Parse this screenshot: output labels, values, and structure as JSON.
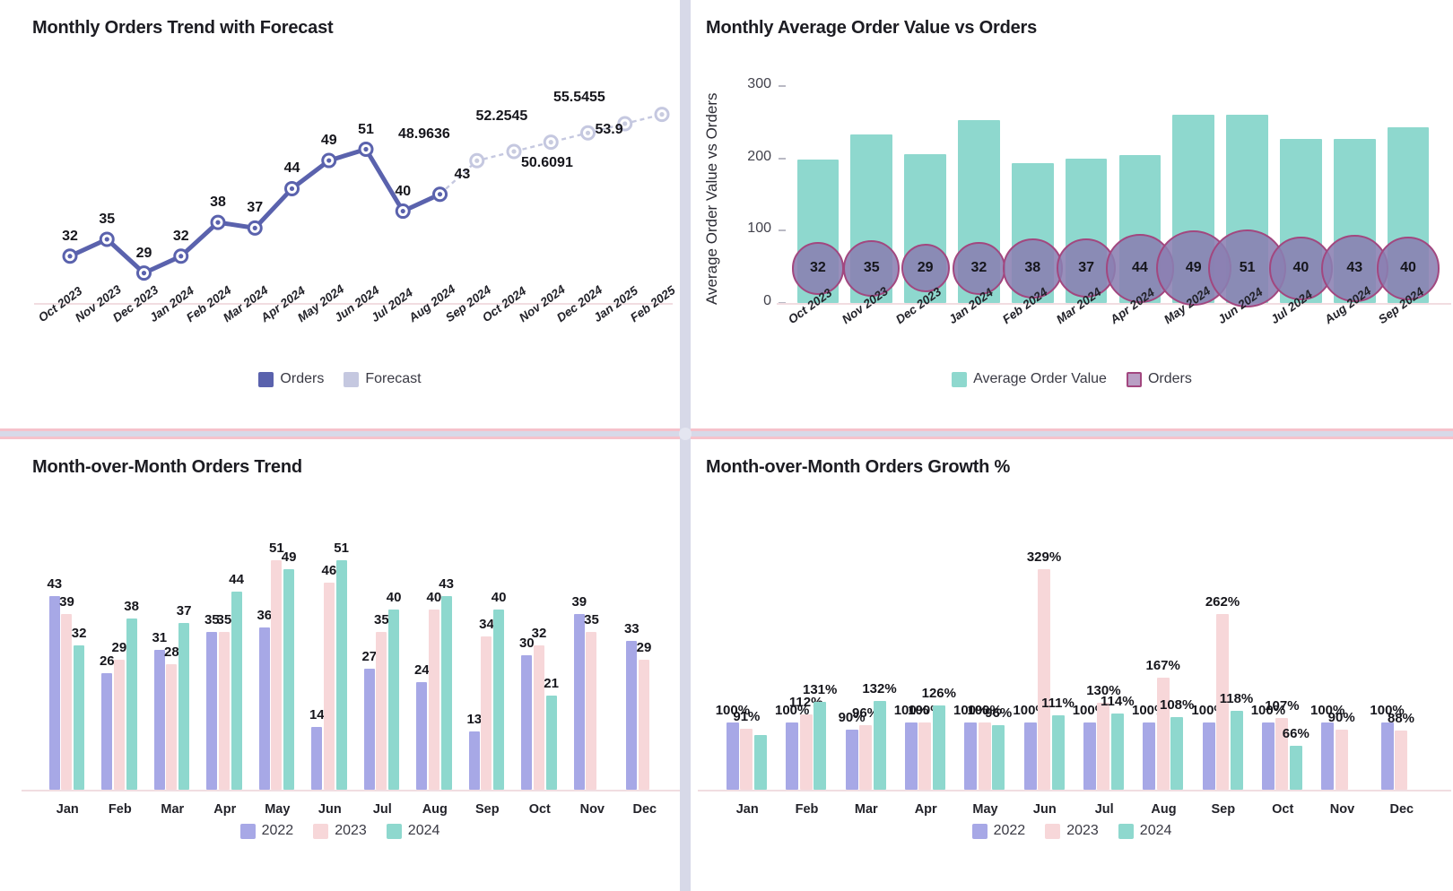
{
  "colors": {
    "orders_line": "#5a62ad",
    "forecast_line": "#c5c8e0",
    "aov_bar": "#8ed8ce",
    "orders_bubble": "#a2477f",
    "y2022": "#a7a8e6",
    "y2023": "#f7d7d9",
    "y2024": "#8ed8ce",
    "divider_pink": "#f6c2cb",
    "divider_gray": "#d7d9e8"
  },
  "panels": {
    "top_left": {
      "title": "Monthly Orders Trend with Forecast"
    },
    "top_right": {
      "title": "Monthly Average Order Value vs Orders"
    },
    "bottom_left": {
      "title": "Month-over-Month Orders Trend"
    },
    "bottom_right": {
      "title": "Month-over-Month Orders Growth %"
    }
  },
  "legends": {
    "top_left": [
      {
        "label": "Orders",
        "color": "#5a62ad"
      },
      {
        "label": "Forecast",
        "color": "#c5c8e0"
      }
    ],
    "top_right": [
      {
        "label": "Average Order Value",
        "color": "#8ed8ce"
      },
      {
        "label": "Orders",
        "color": "#b99fc4"
      }
    ],
    "bottom_left": [
      {
        "label": "2022",
        "color": "#a7a8e6"
      },
      {
        "label": "2023",
        "color": "#f7d7d9"
      },
      {
        "label": "2024",
        "color": "#8ed8ce"
      }
    ],
    "bottom_right": [
      {
        "label": "2022",
        "color": "#a7a8e6"
      },
      {
        "label": "2023",
        "color": "#f7d7d9"
      },
      {
        "label": "2024",
        "color": "#8ed8ce"
      }
    ]
  },
  "chart_data": [
    {
      "id": "orders_trend_forecast",
      "type": "line",
      "title": "Monthly Orders Trend with Forecast",
      "xlabel": "",
      "ylabel": "",
      "grid": false,
      "legend_position": "bottom",
      "ylim": [
        20,
        60
      ],
      "categories": [
        "Oct 2023",
        "Nov 2023",
        "Dec 2023",
        "Jan 2024",
        "Feb 2024",
        "Mar 2024",
        "Apr 2024",
        "May 2024",
        "Jun 2024",
        "Jul 2024",
        "Aug 2024",
        "Sep 2024",
        "Oct 2024",
        "Nov 2024",
        "Dec 2024",
        "Jan 2025",
        "Feb 2025"
      ],
      "series": [
        {
          "name": "Orders",
          "color": "#5a62ad",
          "style": "solid",
          "values": [
            32,
            35,
            29,
            32,
            38,
            37,
            44,
            49,
            51,
            40,
            43,
            null,
            null,
            null,
            null,
            null,
            null
          ],
          "labels": [
            "32",
            "35",
            "29",
            "32",
            "38",
            "37",
            "44",
            "49",
            "51",
            "40",
            "43",
            "",
            "",
            "",
            "",
            "",
            ""
          ]
        },
        {
          "name": "Forecast",
          "color": "#c5c8e0",
          "style": "dashed",
          "values": [
            null,
            null,
            null,
            null,
            null,
            null,
            null,
            null,
            null,
            null,
            43,
            48.9636,
            50.6091,
            52.2545,
            53.9,
            55.5455,
            null
          ],
          "labels": [
            "",
            "",
            "",
            "",
            "",
            "",
            "",
            "",
            "",
            "",
            "",
            "48.9636",
            "50.6091",
            "52.2545",
            "53.9",
            "55.5455",
            ""
          ]
        }
      ],
      "forecast_extra_point": {
        "category": "Feb 2025",
        "value": 57.19,
        "label": ""
      }
    },
    {
      "id": "aov_vs_orders",
      "type": "bar",
      "title": "Monthly Average Order Value vs Orders",
      "xlabel": "",
      "ylabel": "Average Order Value vs Orders",
      "grid": false,
      "legend_position": "bottom",
      "ylim": [
        0,
        310
      ],
      "yticks": [
        0,
        100,
        200,
        300
      ],
      "categories": [
        "Oct 2023",
        "Nov 2023",
        "Dec 2023",
        "Jan 2024",
        "Feb 2024",
        "Mar 2024",
        "Apr 2024",
        "May 2024",
        "Jun 2024",
        "Jul 2024",
        "Aug 2024",
        "Sep 2024"
      ],
      "series": [
        {
          "name": "Average Order Value",
          "color": "#8ed8ce",
          "render": "bar",
          "values": [
            199,
            233,
            206,
            253,
            194,
            200,
            205,
            260,
            260,
            227,
            227,
            243
          ]
        },
        {
          "name": "Orders",
          "color": "#a2477f",
          "render": "bubble",
          "values": [
            32,
            35,
            29,
            32,
            38,
            37,
            44,
            49,
            51,
            40,
            43,
            40
          ],
          "labels": [
            "32",
            "35",
            "29",
            "32",
            "38",
            "37",
            "44",
            "49",
            "51",
            "40",
            "43",
            "40"
          ]
        }
      ]
    },
    {
      "id": "mom_orders_trend",
      "type": "bar",
      "title": "Month-over-Month Orders Trend",
      "xlabel": "",
      "ylabel": "",
      "grid": false,
      "legend_position": "bottom",
      "ylim": [
        0,
        56
      ],
      "categories": [
        "Jan",
        "Feb",
        "Mar",
        "Apr",
        "May",
        "Jun",
        "Jul",
        "Aug",
        "Sep",
        "Oct",
        "Nov",
        "Dec"
      ],
      "series": [
        {
          "name": "2022",
          "color": "#a7a8e6",
          "values": [
            43,
            26,
            31,
            35,
            36,
            14,
            27,
            24,
            13,
            30,
            39,
            33
          ],
          "labels": [
            "43",
            "26",
            "31",
            "35",
            "36",
            "14",
            "27",
            "24",
            "13",
            "30",
            "39",
            "33"
          ]
        },
        {
          "name": "2023",
          "color": "#f7d7d9",
          "values": [
            39,
            29,
            28,
            35,
            51,
            46,
            35,
            40,
            34,
            32,
            35,
            29
          ],
          "labels": [
            "39",
            "29",
            "28",
            "35",
            "51",
            "46",
            "35",
            "40",
            "34",
            "32",
            "35",
            "29"
          ]
        },
        {
          "name": "2024",
          "color": "#8ed8ce",
          "values": [
            32,
            38,
            37,
            44,
            49,
            51,
            40,
            43,
            40,
            21,
            null,
            null
          ],
          "labels": [
            "32",
            "38",
            "37",
            "44",
            "49",
            "51",
            "40",
            "43",
            "40",
            "21",
            "",
            ""
          ]
        }
      ]
    },
    {
      "id": "mom_orders_growth",
      "type": "bar",
      "title": "Month-over-Month Orders Growth %",
      "xlabel": "",
      "ylabel": "",
      "grid": false,
      "legend_position": "bottom",
      "ylim": [
        0,
        350
      ],
      "categories": [
        "Jan",
        "Feb",
        "Mar",
        "Apr",
        "May",
        "Jun",
        "Jul",
        "Aug",
        "Sep",
        "Oct",
        "Nov",
        "Dec"
      ],
      "series": [
        {
          "name": "2022",
          "color": "#a7a8e6",
          "values": [
            100,
            100,
            90,
            100,
            100,
            100,
            100,
            100,
            100,
            100,
            100,
            100
          ],
          "labels": [
            "100%",
            "100%",
            "90%",
            "100%",
            "100%",
            "100%",
            "100%",
            "100%",
            "100%",
            "100%",
            "100%",
            "100%"
          ]
        },
        {
          "name": "2023",
          "color": "#f7d7d9",
          "values": [
            91,
            112,
            96,
            100,
            100,
            329,
            130,
            167,
            262,
            107,
            90,
            88
          ],
          "labels": [
            "91%",
            "112%",
            "96%",
            "100%",
            "100%",
            "329%",
            "130%",
            "167%",
            "262%",
            "107%",
            "90%",
            "88%"
          ]
        },
        {
          "name": "2024",
          "color": "#8ed8ce",
          "values": [
            82,
            131,
            132,
            126,
            96,
            111,
            114,
            108,
            118,
            66,
            null,
            null
          ],
          "labels": [
            "",
            "131%",
            "132%",
            "126%",
            "96%",
            "111%",
            "114%",
            "108%",
            "118%",
            "66%",
            "",
            ""
          ]
        }
      ]
    }
  ]
}
